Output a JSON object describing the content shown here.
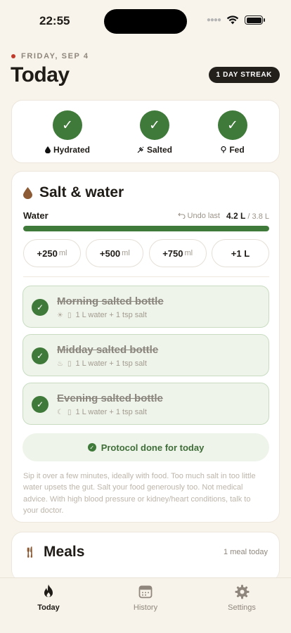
{
  "status_bar": {
    "time": "22:55"
  },
  "header": {
    "date": "FRIDAY, SEP 4",
    "title": "Today",
    "streak": "1 DAY STREAK"
  },
  "status_summary": [
    {
      "label": "Hydrated",
      "icon": "drop-icon",
      "done": true
    },
    {
      "label": "Salted",
      "icon": "salt-shaker-icon",
      "done": true
    },
    {
      "label": "Fed",
      "icon": "utensil-icon",
      "done": true
    }
  ],
  "salt_water": {
    "title": "Salt & water",
    "water_label": "Water",
    "undo_label": "Undo last",
    "amount": "4.2 L",
    "goal": "/ 3.8 L",
    "progress_fraction": 1.0,
    "quick_add": [
      {
        "value": "+250",
        "unit": "ml"
      },
      {
        "value": "+500",
        "unit": "ml"
      },
      {
        "value": "+750",
        "unit": "ml"
      },
      {
        "value": "+1 L",
        "unit": ""
      }
    ],
    "bottles": [
      {
        "title": "Morning salted bottle",
        "recipe": "1 L water + 1 tsp salt",
        "time_icon": "sun-icon",
        "done": true
      },
      {
        "title": "Midday salted bottle",
        "recipe": "1 L water + 1 tsp salt",
        "time_icon": "flame-icon",
        "done": true
      },
      {
        "title": "Evening salted bottle",
        "recipe": "1 L water + 1 tsp salt",
        "time_icon": "moon-icon",
        "done": true
      }
    ],
    "done_message": "Protocol done for today",
    "disclaimer": "Sip it over a few minutes, ideally with food. Too much salt in too little water upsets the gut. Salt your food generously too. Not medical advice. With high blood pressure or kidney/heart conditions, talk to your doctor."
  },
  "meals": {
    "title": "Meals",
    "count": "1 meal today"
  },
  "tabs": [
    {
      "label": "Today",
      "icon": "flame-icon",
      "active": true
    },
    {
      "label": "History",
      "icon": "calendar-icon",
      "active": false
    },
    {
      "label": "Settings",
      "icon": "gear-icon",
      "active": false
    }
  ],
  "colors": {
    "background": "#f8f4ec",
    "accent_green": "#3f7a3a",
    "accent_brown": "#8c5a35",
    "date_dot": "#c0392b"
  }
}
